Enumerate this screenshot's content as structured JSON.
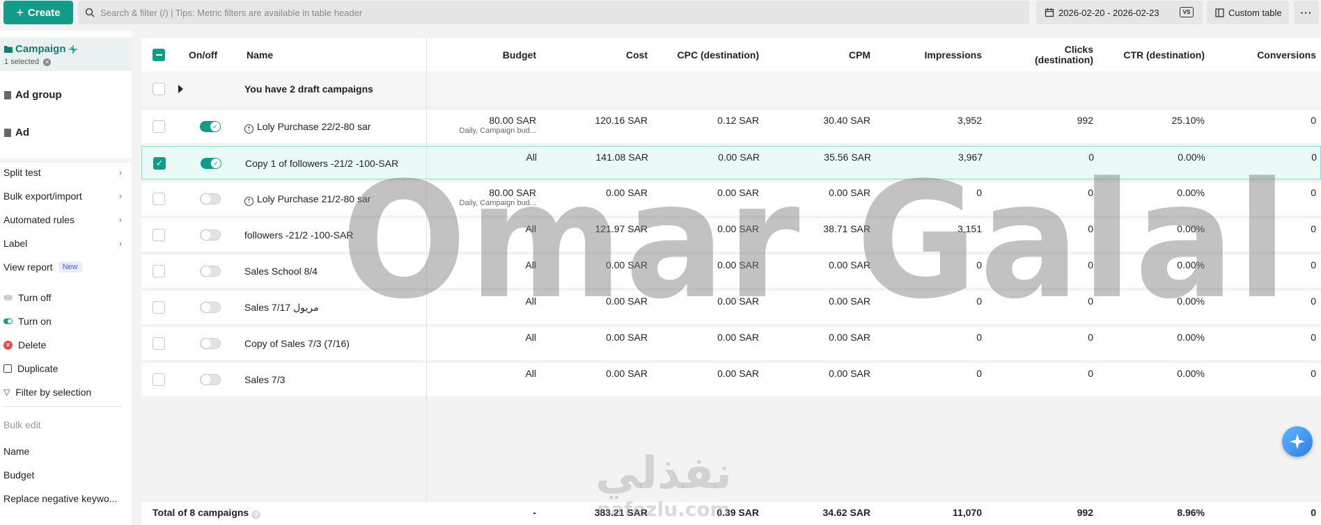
{
  "topbar": {
    "create_label": "Create",
    "search_placeholder": "Search & filter (/) | Tips: Metric filters are available in table header",
    "date_range": "2026-02-20 - 2026-02-23",
    "vs_label": "VS",
    "custom_table_label": "Custom table",
    "more_label": "···"
  },
  "sidebar": {
    "campaign_label": "Campaign",
    "selected_text": "1 selected",
    "adgroup_label": "Ad group",
    "ad_label": "Ad",
    "menu": [
      {
        "label": "Split test"
      },
      {
        "label": "Bulk export/import"
      },
      {
        "label": "Automated rules"
      },
      {
        "label": "Label"
      },
      {
        "label": "View report",
        "badge": "New"
      }
    ],
    "actions": [
      {
        "label": "Turn off"
      },
      {
        "label": "Turn on"
      },
      {
        "label": "Delete"
      },
      {
        "label": "Duplicate"
      },
      {
        "label": "Filter by selection"
      }
    ],
    "bulk_edit_title": "Bulk edit",
    "bulk_items": [
      {
        "label": "Name"
      },
      {
        "label": "Budget"
      },
      {
        "label": "Replace negative keywo..."
      }
    ]
  },
  "table": {
    "headers": {
      "onoff": "On/off",
      "name": "Name",
      "budget": "Budget",
      "cost": "Cost",
      "cpc": "CPC (destination)",
      "cpm": "CPM",
      "impressions": "Impressions",
      "clicks_line1": "Clicks",
      "clicks_line2": "(destination)",
      "ctr": "CTR (destination)",
      "conversions": "Conversions"
    },
    "draft_text": "You have 2 draft campaigns",
    "rows": [
      {
        "name": "Loly Purchase 22/2-80 sar",
        "on": true,
        "checked": false,
        "icon": true,
        "budget": "80.00 SAR",
        "budget_sub": "Daily, Campaign bud...",
        "cost": "120.16 SAR",
        "cpc": "0.12 SAR",
        "cpm": "30.40 SAR",
        "impressions": "3,952",
        "clicks": "992",
        "ctr": "25.10%",
        "conversions": "0"
      },
      {
        "name": "Copy 1 of followers -21/2 -100-SAR",
        "on": true,
        "checked": true,
        "icon": false,
        "budget": "All",
        "budget_sub": "",
        "cost": "141.08 SAR",
        "cpc": "0.00 SAR",
        "cpm": "35.56 SAR",
        "impressions": "3,967",
        "clicks": "0",
        "ctr": "0.00%",
        "conversions": "0"
      },
      {
        "name": "Loly Purchase 21/2-80 sar",
        "on": false,
        "checked": false,
        "icon": true,
        "budget": "80.00 SAR",
        "budget_sub": "Daily, Campaign bud...",
        "cost": "0.00 SAR",
        "cpc": "0.00 SAR",
        "cpm": "0.00 SAR",
        "impressions": "0",
        "clicks": "0",
        "ctr": "0.00%",
        "conversions": "0"
      },
      {
        "name": "followers -21/2 -100-SAR",
        "on": false,
        "checked": false,
        "icon": false,
        "budget": "All",
        "budget_sub": "",
        "cost": "121.97 SAR",
        "cpc": "0.00 SAR",
        "cpm": "38.71 SAR",
        "impressions": "3,151",
        "clicks": "0",
        "ctr": "0.00%",
        "conversions": "0"
      },
      {
        "name": "Sales School 8/4",
        "on": false,
        "checked": false,
        "icon": false,
        "budget": "All",
        "budget_sub": "",
        "cost": "0.00 SAR",
        "cpc": "0.00 SAR",
        "cpm": "0.00 SAR",
        "impressions": "0",
        "clicks": "0",
        "ctr": "0.00%",
        "conversions": "0"
      },
      {
        "name": "Sales 7/17 مريول",
        "on": false,
        "checked": false,
        "icon": false,
        "budget": "All",
        "budget_sub": "",
        "cost": "0.00 SAR",
        "cpc": "0.00 SAR",
        "cpm": "0.00 SAR",
        "impressions": "0",
        "clicks": "0",
        "ctr": "0.00%",
        "conversions": "0"
      },
      {
        "name": "Copy of Sales 7/3 (7/16)",
        "on": false,
        "checked": false,
        "icon": false,
        "budget": "All",
        "budget_sub": "",
        "cost": "0.00 SAR",
        "cpc": "0.00 SAR",
        "cpm": "0.00 SAR",
        "impressions": "0",
        "clicks": "0",
        "ctr": "0.00%",
        "conversions": "0"
      },
      {
        "name": "Sales 7/3",
        "on": false,
        "checked": false,
        "icon": false,
        "budget": "All",
        "budget_sub": "",
        "cost": "0.00 SAR",
        "cpc": "0.00 SAR",
        "cpm": "0.00 SAR",
        "impressions": "0",
        "clicks": "0",
        "ctr": "0.00%",
        "conversions": "0"
      }
    ],
    "total": {
      "label": "Total of 8 campaigns",
      "budget": "-",
      "cost": "383.21 SAR",
      "cpc": "0.39 SAR",
      "cpm": "34.62 SAR",
      "impressions": "11,070",
      "clicks": "992",
      "ctr": "8.96%",
      "conversions": "0"
    }
  },
  "watermark": {
    "text": "Omar Galal",
    "logo_arabic": "نفذلي",
    "logo_latin": "nafezlu.com"
  },
  "colors": {
    "accent": "#119c8a",
    "selected_row": "#eafaf7",
    "delete": "#e04b4b"
  }
}
